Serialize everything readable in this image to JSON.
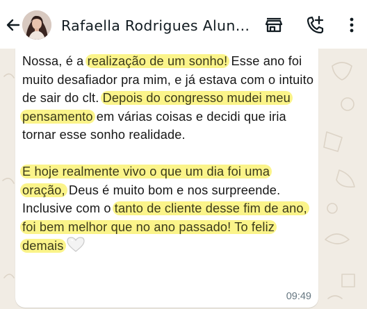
{
  "header": {
    "title": "Rafaella Rodrigues Alun…"
  },
  "message": {
    "segments": {
      "p1a": "Nossa, é a ",
      "p1h1": "realização de um sonho!",
      "p1b": " Esse ano foi muito desafiador pra mim, e já estava com o intuito de sair do clt. ",
      "p1h2": "Depois do congresso mudei meu pensamento",
      "p1c": " em várias coisas e decidi que iria tornar esse sonho realidade.",
      "p2h1": "E hoje realmente vivo o que um dia foi uma oração,",
      "p2a": " Deus é muito bom e nos surpreende.",
      "p3a": "Inclusive com o ",
      "p3h1": "tanto de cliente desse fim de ano, foi bem melhor que no ano passado! To feliz demais"
    },
    "time": "09:49",
    "highlight_color": "#fbf48a"
  },
  "icons": [
    "back-arrow-icon",
    "avatar",
    "store-icon",
    "add-call-icon",
    "more-vert-icon",
    "white-heart-emoji"
  ]
}
